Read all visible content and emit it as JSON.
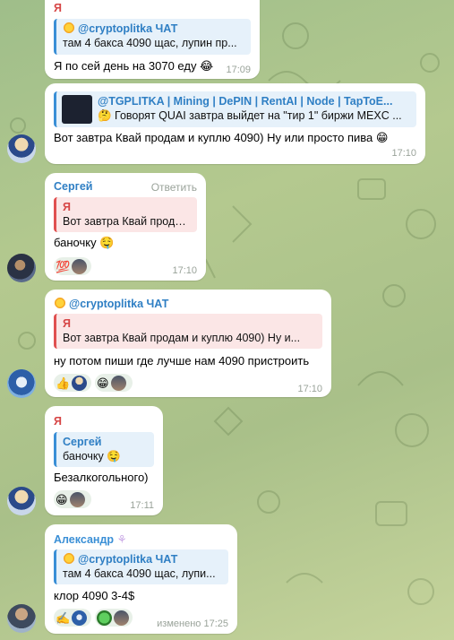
{
  "messages": [
    {
      "sender": "Я",
      "quote": {
        "name": "@cryptoplitka ЧАТ",
        "text": "там 4 баксa 4090 щас, лупин пр..."
      },
      "text": "Я по сей день на 3070 еду 😂",
      "time": "17:09"
    },
    {
      "quote": {
        "name": "@TGPLITKA | Mining | DePIN | RentAI | Node | TapToE...",
        "text": "🤔 Говорят QUAI завтра выйдет на \"тир 1\" биржи MEXC ..."
      },
      "text": "Вот завтра Квай продам и куплю 4090) Ну или просто пива 😁",
      "time": "17:10"
    },
    {
      "sender": "Сергей",
      "reply_label": "Ответить",
      "quote": {
        "name": "Я",
        "text": "Вот завтра Квай продам..."
      },
      "text": "баночку 🤤",
      "reactions": [
        "💯"
      ],
      "time": "17:10"
    },
    {
      "sender": "@cryptoplitka ЧАТ",
      "quote": {
        "name": "Я",
        "text": "Вот завтра Квай продам и куплю 4090) Ну и..."
      },
      "text": "ну потом пиши где лучше нам 4090 пристроить",
      "reactions": [
        "👍",
        "😁"
      ],
      "time": "17:10"
    },
    {
      "sender": "Я",
      "quote": {
        "name": "Сергей",
        "text": "баночку 🤤"
      },
      "text": "Безалкогольного)",
      "reactions": [
        "😁"
      ],
      "time": "17:11"
    },
    {
      "sender": "Александр",
      "quote": {
        "name": "@cryptoplitka ЧАТ",
        "text": "там 4 баксa 4090 щас, лупи..."
      },
      "text": "клор 4090 3-4$",
      "reactions": [
        "✍️"
      ],
      "time": "изменено 17:25"
    }
  ],
  "colors": {
    "me": "#d64545",
    "sergey": "#2f7fc4",
    "channel": "#2f7fc4",
    "aleksandr": "#3a8fd6",
    "time": "#9aa39a"
  }
}
